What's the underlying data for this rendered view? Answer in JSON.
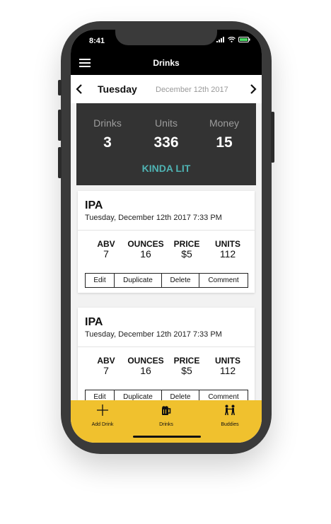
{
  "status": {
    "time": "8:41"
  },
  "nav": {
    "title": "Drinks"
  },
  "date": {
    "day": "Tuesday",
    "full": "December 12th 2017"
  },
  "summary": {
    "drinks_label": "Drinks",
    "drinks_value": "3",
    "units_label": "Units",
    "units_value": "336",
    "money_label": "Money",
    "money_value": "15",
    "status": "KINDA LIT",
    "status_color": "#4fb3b3"
  },
  "entries": [
    {
      "name": "IPA",
      "time": "Tuesday, December 12th 2017 7:33 PM",
      "abv_label": "ABV",
      "abv": "7",
      "ounces_label": "OUNCES",
      "ounces": "16",
      "price_label": "PRICE",
      "price": "$5",
      "units_label": "UNITS",
      "units": "112",
      "actions": [
        "Edit",
        "Duplicate",
        "Delete",
        "Comment"
      ]
    },
    {
      "name": "IPA",
      "time": "Tuesday, December 12th 2017 7:33 PM",
      "abv_label": "ABV",
      "abv": "7",
      "ounces_label": "OUNCES",
      "ounces": "16",
      "price_label": "PRICE",
      "price": "$5",
      "units_label": "UNITS",
      "units": "112",
      "actions": [
        "Edit",
        "Duplicate",
        "Delete",
        "Comment"
      ]
    }
  ],
  "tabs": [
    {
      "label": "Add Drink",
      "icon": "plus-icon"
    },
    {
      "label": "Drinks",
      "icon": "beer-mug-icon"
    },
    {
      "label": "Buddies",
      "icon": "buddies-icon"
    }
  ],
  "colors": {
    "accent": "#f0c12e",
    "dark": "#333333",
    "topbar": "#000000"
  }
}
